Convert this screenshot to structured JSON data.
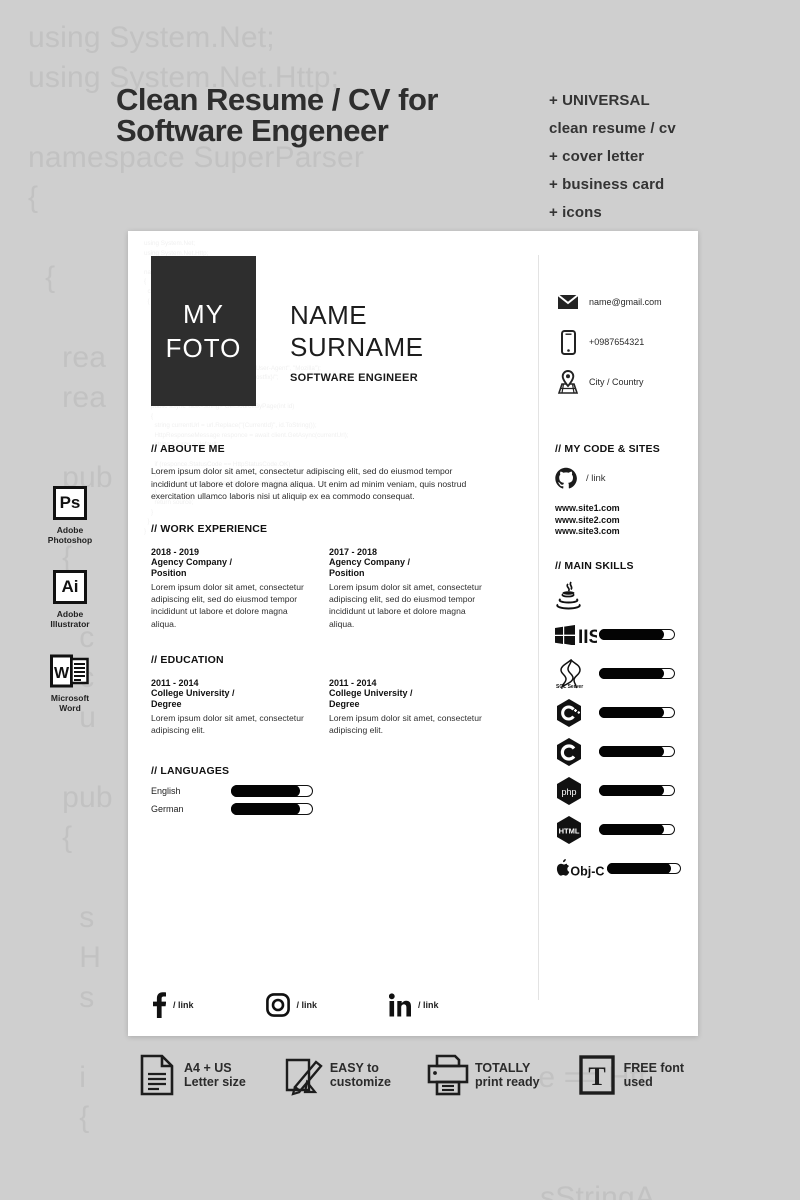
{
  "promo": {
    "title_line1": "Clean Resume / CV for",
    "title_line2": "Software Engeneer",
    "features": [
      "+ UNIVERSAL",
      "clean resume / cv",
      "+ cover letter",
      "+ business card",
      "+ icons"
    ]
  },
  "background_code": "using System.Net;\nusing System.Net.Http;\n\nnamespace SuperParser\n{\n\n  {\n\n    rea\n    rea\n\n    pub\n\n    {\n\n      c                                                     Agent\", \"\n      c                                                     /\";\n      u\n\n    pub                                                     (int id)\n    {\n\n      s                                                     \", id.ToS\n      H                                                     lient.Ge\n      s\n\n      i                                                     e == Htt\n      {\n\n                                                            sStringA\n      }\n      re\n    }\n  }\n}",
  "software": [
    {
      "icon": "photoshop-icon",
      "glyph": "Ps",
      "label_line1": "Adobe",
      "label_line2": "Photoshop"
    },
    {
      "icon": "illustrator-icon",
      "glyph": "Ai",
      "label_line1": "Adobe",
      "label_line2": "Illustrator"
    },
    {
      "icon": "word-icon",
      "glyph": "W",
      "label_line1": "Microsoft",
      "label_line2": "Word"
    }
  ],
  "resume": {
    "card_code_watermark": "using System.Net;\nusing System.Net.Http;\n\nnamespace SuperParser\n{\n  class Parser\n  {\n    readonly HttpClient client;\n    readonly ParserSettings settings;\n\n    public Parser(ParserSettings settings)\n    {\n      client = new HttpClient();\n      client.DefaultRequestHeaders.Add(\"User-Agent\", \"Mozilla\");\n      uri = $\"{settings.BaseUrl}/{settings.Postfix}/\";\n    }\n\n    public async Task<string> GetSourceByPage(int id)\n    {\n      string currentUrl = url.Replace(\"{CurrentId}\", id.ToString());\n      HttpResponseMessage responce = await client.GetAsync(currentUrl);\n      string source = default;\n\n      if (responce.StatusCode == HttpStatusCode.OK)\n      {\n        source = await responce.Content.ReadAsStringAsync();\n      }\n      return source;\n    }\n  }\n}",
    "photo_line1": "MY",
    "photo_line2": "FOTO",
    "first_name": "NAME",
    "last_name": "SURNAME",
    "role": "SOFTWARE ENGINEER",
    "contacts": [
      {
        "icon": "envelope-icon",
        "text": "name@gmail.com"
      },
      {
        "icon": "mobile-phone-icon",
        "text": "+0987654321"
      },
      {
        "icon": "map-pin-icon",
        "text": "City / Country"
      }
    ],
    "about": {
      "heading": "ABOUTE ME",
      "text": "Lorem ipsum dolor sit amet, consectetur adipiscing elit, sed do eiusmod tempor incididunt ut labore et dolore magna aliqua. Ut enim ad minim veniam, quis nostrud exercitation ullamco laboris nisi ut aliquip ex ea commodo consequat."
    },
    "work": {
      "heading": "WORK EXPERIENCE",
      "items": [
        {
          "years": "2018 - 2019",
          "org_line1": "Agency Company /",
          "org_line2": "Position",
          "desc": "Lorem ipsum dolor sit amet, consectetur adipiscing elit, sed do eiusmod tempor incididunt ut labore et dolore magna aliqua."
        },
        {
          "years": "2017 - 2018",
          "org_line1": "Agency Company /",
          "org_line2": "Position",
          "desc": "Lorem ipsum dolor sit amet, consectetur adipiscing elit, sed do eiusmod tempor incididunt ut labore et dolore magna aliqua."
        }
      ]
    },
    "education": {
      "heading": "EDUCATION",
      "items": [
        {
          "years": "2011 - 2014",
          "org_line1": "College University /",
          "org_line2": "Degree",
          "desc": "Lorem ipsum dolor sit amet, consectetur adipiscing elit."
        },
        {
          "years": "2011 - 2014",
          "org_line1": "College University /",
          "org_line2": "Degree",
          "desc": "Lorem ipsum dolor sit amet, consectetur adipiscing elit."
        }
      ]
    },
    "languages": {
      "heading": "LANGUAGES",
      "items": [
        {
          "name": "English",
          "level": 84
        },
        {
          "name": "German",
          "level": 84
        }
      ]
    },
    "code_sites": {
      "heading": "MY CODE & SITES",
      "github_icon": "github-icon",
      "github_link": "/ link",
      "sites": [
        "www.site1.com",
        "www.site2.com",
        "www.site3.com"
      ]
    },
    "main_skills": {
      "heading": "MAIN SKILLS",
      "items": [
        {
          "icon": "java-icon",
          "label": "",
          "level": null
        },
        {
          "icon": "windows-iis-icon",
          "label": "IIS",
          "level": 86
        },
        {
          "icon": "sql-server-icon",
          "label": "SQL Server",
          "level": 86
        },
        {
          "icon": "c-plus-plus-icon",
          "label": "",
          "level": 86
        },
        {
          "icon": "c-sharp-icon",
          "label": "",
          "level": 86
        },
        {
          "icon": "php-icon",
          "label": "php",
          "level": 86
        },
        {
          "icon": "html-icon",
          "label": "HTML",
          "level": 86
        },
        {
          "icon": "apple-objc-icon",
          "label": "Obj-C",
          "level": 86
        }
      ]
    },
    "socials": [
      {
        "icon": "facebook-icon",
        "link": "/ link"
      },
      {
        "icon": "instagram-icon",
        "link": "/ link"
      },
      {
        "icon": "linkedin-icon",
        "link": "/ link"
      }
    ]
  },
  "footer_features": [
    {
      "icon": "document-page-icon",
      "line1": "A4 + US",
      "line2": "Letter size"
    },
    {
      "icon": "pencil-edit-icon",
      "line1": "EASY to",
      "line2": "customize"
    },
    {
      "icon": "printer-icon",
      "line1": "TOTALLY",
      "line2": "print ready"
    },
    {
      "icon": "font-t-icon",
      "line1": "FREE font",
      "line2": "used"
    }
  ],
  "colors": {
    "background": "#cfcfcf",
    "card": "#ffffff",
    "ink": "#2e2e2e",
    "photo_block": "#2e2e2e",
    "watermark": "#c2c2c2"
  }
}
